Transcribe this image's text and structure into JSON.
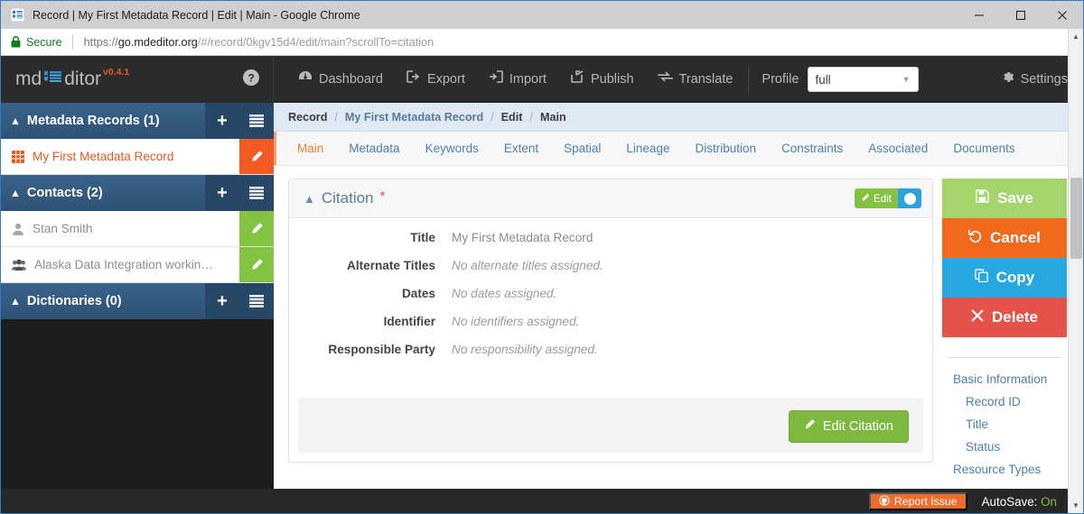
{
  "window": {
    "title": "Record | My First Metadata Record | Edit | Main - Google Chrome",
    "favicon": "mdeditor-icon",
    "minimize": "minimize-icon",
    "maximize": "maximize-icon",
    "close": "close-icon"
  },
  "address": {
    "secure_label": "Secure",
    "lock": "lock-icon",
    "url_prefix": "https://",
    "url_domain": "go.mdeditor.org",
    "url_path": "/#/record/0kgv15d4/edit/main?scrollTo=citation"
  },
  "brand": {
    "part1": "md",
    "part2": "ditor",
    "version": "v0.4.1",
    "help": "help-icon"
  },
  "topnav": {
    "items": [
      {
        "label": "Dashboard",
        "icon": "dashboard-icon"
      },
      {
        "label": "Export",
        "icon": "export-icon"
      },
      {
        "label": "Import",
        "icon": "import-icon"
      },
      {
        "label": "Publish",
        "icon": "publish-icon"
      },
      {
        "label": "Translate",
        "icon": "translate-icon"
      }
    ],
    "profile_label": "Profile",
    "profile_value": "full",
    "profile_options": [
      "full"
    ],
    "settings_label": "Settings",
    "settings_icon": "gear-icon"
  },
  "sidebar": {
    "sections": [
      {
        "title": "Metadata Records (1)",
        "add": "plus-icon",
        "list": "list-icon",
        "items": [
          {
            "label": "My First Metadata Record",
            "icon": "table-icon",
            "active": true,
            "edit": "pencil-icon"
          }
        ]
      },
      {
        "title": "Contacts (2)",
        "add": "plus-icon",
        "list": "list-icon",
        "items": [
          {
            "label": "Stan Smith",
            "icon": "person-icon",
            "active": false,
            "edit": "pencil-icon"
          },
          {
            "label": "Alaska Data Integration working…",
            "icon": "group-icon",
            "active": false,
            "edit": "pencil-icon"
          }
        ]
      },
      {
        "title": "Dictionaries (0)",
        "add": "plus-icon",
        "list": "list-icon",
        "items": []
      }
    ]
  },
  "breadcrumb": {
    "items": [
      "Record",
      "My First Metadata Record",
      "Edit",
      "Main"
    ],
    "separator": "/"
  },
  "tabs": [
    {
      "label": "Main",
      "active": true
    },
    {
      "label": "Metadata",
      "active": false
    },
    {
      "label": "Keywords",
      "active": false
    },
    {
      "label": "Extent",
      "active": false
    },
    {
      "label": "Spatial",
      "active": false
    },
    {
      "label": "Lineage",
      "active": false
    },
    {
      "label": "Distribution",
      "active": false
    },
    {
      "label": "Constraints",
      "active": false
    },
    {
      "label": "Associated",
      "active": false
    },
    {
      "label": "Documents",
      "active": false
    }
  ],
  "citation": {
    "title": "Citation",
    "required_marker": "*",
    "collapse_caret": "chevron-up-icon",
    "edit_toggle_label": "Edit",
    "edit_toggle_icon": "pencil-icon",
    "edit_toggle_state": "on",
    "fields": [
      {
        "label": "Title",
        "value": "My First Metadata Record",
        "placeholder": false
      },
      {
        "label": "Alternate Titles",
        "value": "No alternate titles assigned.",
        "placeholder": true
      },
      {
        "label": "Dates",
        "value": "No dates assigned.",
        "placeholder": true
      },
      {
        "label": "Identifier",
        "value": "No identifiers assigned.",
        "placeholder": true
      },
      {
        "label": "Responsible Party",
        "value": "No responsibility assigned.",
        "placeholder": true
      }
    ],
    "footer_button": {
      "label": "Edit Citation",
      "icon": "pencil-icon"
    }
  },
  "rail": {
    "actions": [
      {
        "label": "Save",
        "icon": "save-icon",
        "color": "#a4d46b"
      },
      {
        "label": "Cancel",
        "icon": "undo-icon",
        "color": "#f2691d"
      },
      {
        "label": "Copy",
        "icon": "copy-icon",
        "color": "#27a8e0"
      },
      {
        "label": "Delete",
        "icon": "x-icon",
        "color": "#e4524a"
      }
    ],
    "nav": [
      {
        "label": "Basic Information",
        "sub": false
      },
      {
        "label": "Record ID",
        "sub": true
      },
      {
        "label": "Title",
        "sub": true
      },
      {
        "label": "Status",
        "sub": true
      },
      {
        "label": "Resource Types",
        "sub": false
      }
    ]
  },
  "statusbar": {
    "report_label": "Report Issue",
    "report_icon": "github-icon",
    "autosave_label": "AutoSave:",
    "autosave_value": "On"
  },
  "scrollbar": {
    "up": "triangle-up-icon",
    "down": "triangle-down-icon"
  },
  "colors": {
    "accent_orange": "#e8591f",
    "brand_blue": "#2f5276",
    "green": "#7db83f",
    "blue": "#27a8e0",
    "red": "#e4524a"
  }
}
